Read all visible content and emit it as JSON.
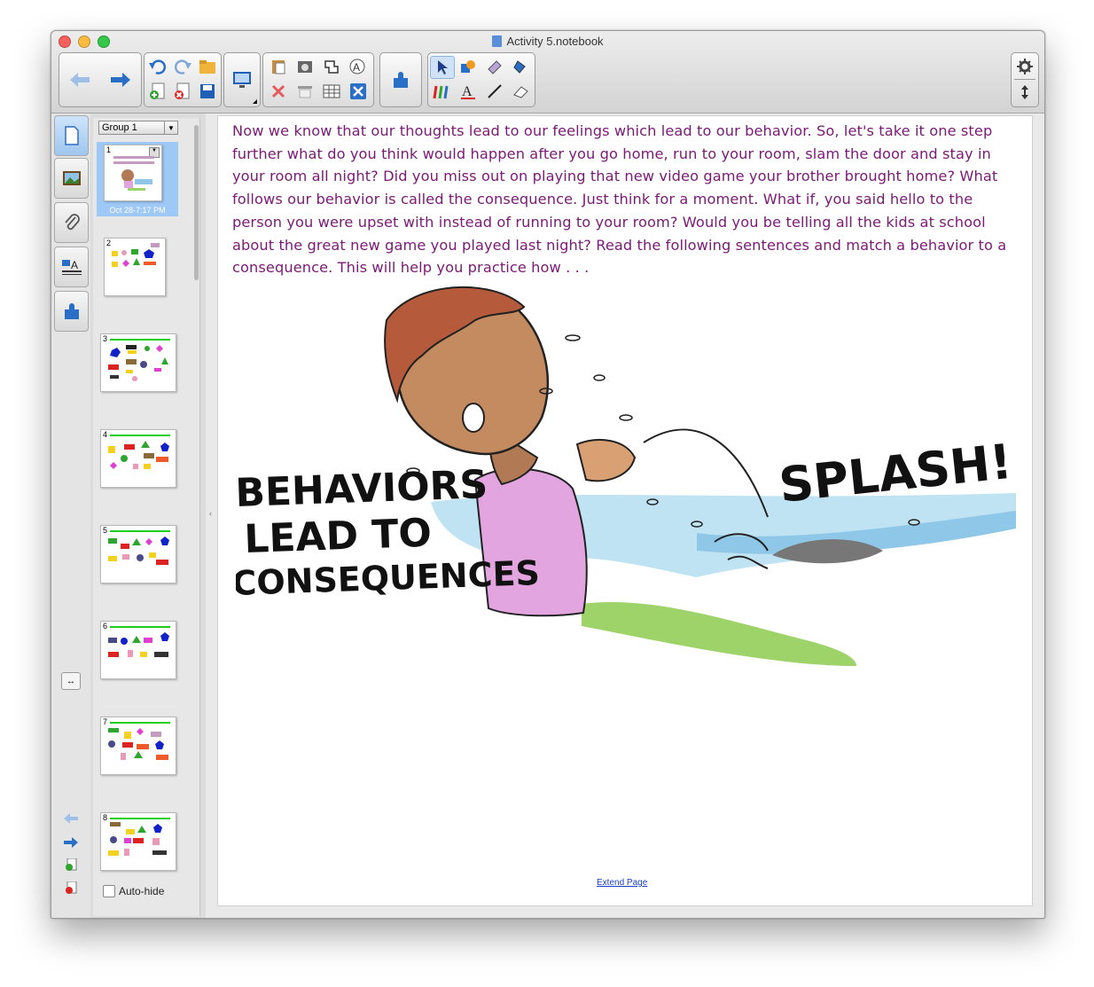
{
  "window": {
    "title": "Activity 5.notebook"
  },
  "sorter": {
    "group_label": "Group 1",
    "selected_timestamp": "Oct 28-7:17 PM",
    "page_numbers": [
      "1",
      "2",
      "3",
      "4",
      "5",
      "6",
      "7",
      "8"
    ],
    "autohide_label": "Auto-hide"
  },
  "page": {
    "paragraph": "Now we know that our thoughts lead to our feelings which lead to our behavior.  So, let's take it one step further what do you think would happen after you go home, run to your room, slam the door and stay in your room all night?  Did you miss out on playing that new video game your brother brought home?  What follows our behavior is called the consequence.  Just think for a moment.  What if, you said hello to the person you were upset with instead of running to your room?  Would you be telling all the kids at school about the great new game you played last night?  Read the following sentences and match a behavior to a consequence.  This will help you practice how . . .",
    "cartoon_text_left": "BEHAVIORS LEAD TO CONSEQUENCES",
    "cartoon_text_right": "SPLASH!",
    "extend_link": "Extend Page"
  },
  "colors": {
    "text_purple": "#7b1a76",
    "selection_blue": "#9ec8f5",
    "accent_blue": "#2a6fc7"
  },
  "icons": [
    "back-arrow-icon",
    "forward-arrow-icon",
    "undo-icon",
    "redo-icon",
    "open-folder-icon",
    "add-page-icon",
    "delete-page-icon",
    "save-icon",
    "screen-shade-icon",
    "paste-icon",
    "screen-capture-icon",
    "clone-icon",
    "math-icon",
    "delete-icon",
    "show-hide-icon",
    "table-icon",
    "close-icon",
    "addon-icon",
    "select-icon",
    "shapes-icon",
    "magic-pen-icon",
    "fill-icon",
    "pens-icon",
    "text-icon",
    "lines-icon",
    "eraser-icon",
    "gear-icon",
    "move-toolbar-icon"
  ]
}
